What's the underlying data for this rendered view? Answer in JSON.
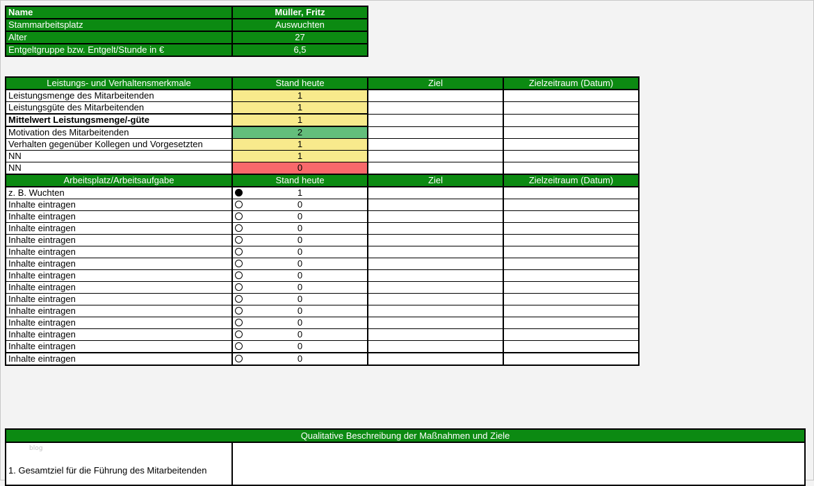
{
  "info": {
    "rows": [
      {
        "label": "Name",
        "value": "Müller, Fritz"
      },
      {
        "label": "Stammarbeitsplatz",
        "value": "Auswuchten"
      },
      {
        "label": "Alter",
        "value": "27"
      },
      {
        "label": "Entgeltgruppe bzw. Entgelt/Stunde in €",
        "value": "6,5"
      }
    ]
  },
  "section1": {
    "headers": [
      "Leistungs- und Verhaltensmerkmale",
      "Stand heute",
      "Ziel",
      "Zielzeitraum (Datum)"
    ],
    "rows": [
      {
        "label": "Leistungsmenge des Mitarbeitenden",
        "value": "1",
        "level": "yellow"
      },
      {
        "label": "Leistungsgüte des Mitarbeitenden",
        "value": "1",
        "level": "yellow"
      },
      {
        "label": "Mittelwert Leistungsmenge/-güte",
        "value": "1",
        "level": "yellow"
      },
      {
        "label": "Motivation des Mitarbeitenden",
        "value": "2",
        "level": "green"
      },
      {
        "label": "Verhalten gegenüber Kollegen und Vorgesetzten",
        "value": "1",
        "level": "yellow"
      },
      {
        "label": "NN",
        "value": "1",
        "level": "yellow"
      },
      {
        "label": "NN",
        "value": "0",
        "level": "red"
      }
    ]
  },
  "section2": {
    "headers": [
      "Arbeitsplatz/Arbeitsaufgabe",
      "Stand heute",
      "Ziel",
      "Zielzeitraum (Datum)"
    ],
    "rows": [
      {
        "label": "z. B. Wuchten",
        "value": "1",
        "icon": "filled-circle-icon"
      },
      {
        "label": "Inhalte eintragen",
        "value": "0",
        "icon": "empty-circle-icon"
      },
      {
        "label": "Inhalte eintragen",
        "value": "0",
        "icon": "empty-circle-icon"
      },
      {
        "label": "Inhalte eintragen",
        "value": "0",
        "icon": "empty-circle-icon"
      },
      {
        "label": "Inhalte eintragen",
        "value": "0",
        "icon": "empty-circle-icon"
      },
      {
        "label": "Inhalte eintragen",
        "value": "0",
        "icon": "empty-circle-icon"
      },
      {
        "label": "Inhalte eintragen",
        "value": "0",
        "icon": "empty-circle-icon"
      },
      {
        "label": "Inhalte eintragen",
        "value": "0",
        "icon": "empty-circle-icon"
      },
      {
        "label": "Inhalte eintragen",
        "value": "0",
        "icon": "empty-circle-icon"
      },
      {
        "label": "Inhalte eintragen",
        "value": "0",
        "icon": "empty-circle-icon"
      },
      {
        "label": "Inhalte eintragen",
        "value": "0",
        "icon": "empty-circle-icon"
      },
      {
        "label": "Inhalte eintragen",
        "value": "0",
        "icon": "empty-circle-icon"
      },
      {
        "label": "Inhalte eintragen",
        "value": "0",
        "icon": "empty-circle-icon"
      },
      {
        "label": "Inhalte eintragen",
        "value": "0",
        "icon": "empty-circle-icon"
      },
      {
        "label": "Inhalte eintragen",
        "value": "0",
        "icon": "empty-circle-icon"
      }
    ]
  },
  "section3": {
    "header": "Qualitative Beschreibung der Maßnahmen und Ziele",
    "item": "1. Gesamtziel für die Führung des Mitarbeitenden",
    "watermark": "blog"
  },
  "colors": {
    "header_green": "#0c8a12",
    "yellow": "#f8ea8c",
    "green": "#63be7b",
    "red": "#f8696b"
  }
}
